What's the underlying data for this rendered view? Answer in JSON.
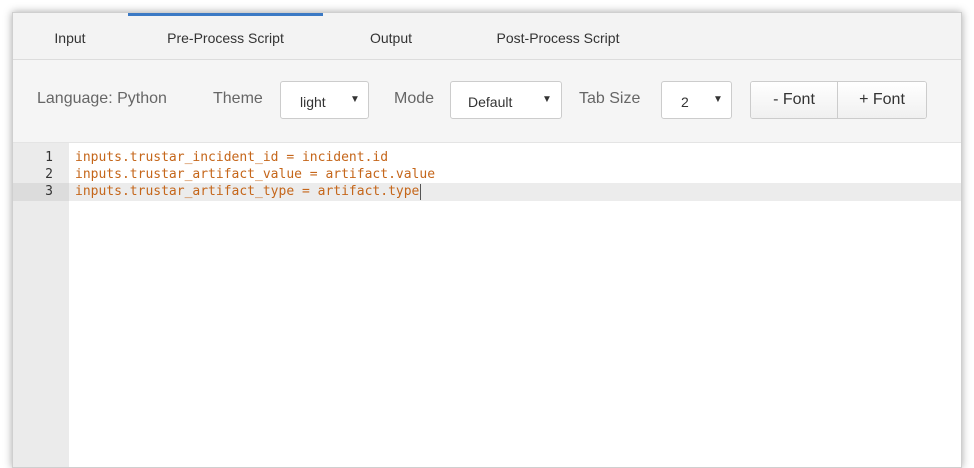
{
  "tabs": [
    {
      "label": "Input"
    },
    {
      "label": "Pre-Process Script",
      "active": true
    },
    {
      "label": "Output"
    },
    {
      "label": "Post-Process Script"
    }
  ],
  "toolbar": {
    "language_label": "Language: Python",
    "theme_label": "Theme",
    "theme_value": "light",
    "mode_label": "Mode",
    "mode_value": "Default",
    "tab_size_label": "Tab Size",
    "tab_size_value": "2",
    "font_minus_label": "- Font",
    "font_plus_label": "+ Font"
  },
  "editor": {
    "current_line": 3,
    "lines": [
      {
        "num": "1",
        "code": "inputs.trustar_incident_id = incident.id"
      },
      {
        "num": "2",
        "code": "inputs.trustar_artifact_value = artifact.value"
      },
      {
        "num": "3",
        "code": "inputs.trustar_artifact_type = artifact.type"
      }
    ]
  },
  "icons": {
    "dropdown": "caret-down-icon"
  },
  "colors": {
    "active_tab_accent": "#3b79c4",
    "code_text": "#c5661a",
    "gutter_bg": "#ebebeb"
  }
}
